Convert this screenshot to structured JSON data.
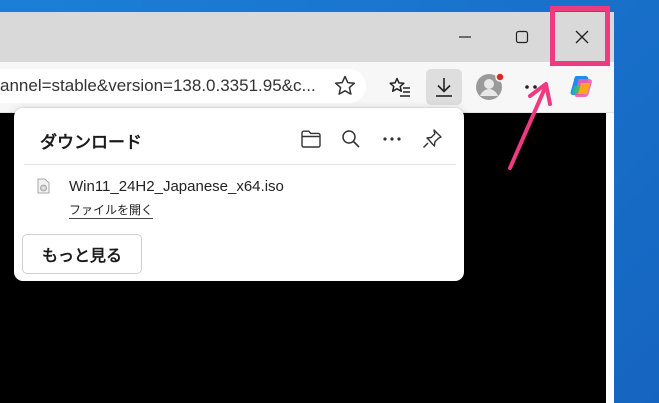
{
  "titlebar": {
    "minimize_icon": "minimize-icon",
    "maximize_icon": "maximize-icon",
    "close_icon": "close-icon"
  },
  "toolbar": {
    "address_text": "annel=stable&version=138.0.3351.95&c...",
    "icons": [
      "star-icon",
      "favorites-icon",
      "download-icon",
      "profile-icon",
      "more-icon",
      "copilot-icon"
    ]
  },
  "downloads": {
    "title": "ダウンロード",
    "file_name": "Win11_24H2_Japanese_x64.iso",
    "open_file_label": "ファイルを開く",
    "more_label": "もっと見る"
  },
  "annotation": {
    "highlight_color": "#ee3a80"
  }
}
